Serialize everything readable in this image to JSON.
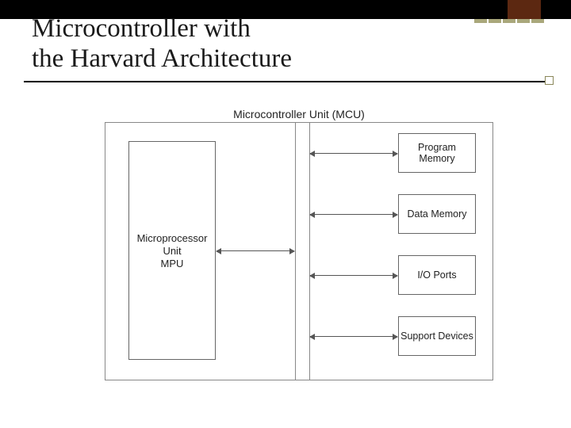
{
  "slide": {
    "title_line1": "Microcontroller with",
    "title_line2": "the Harvard Architecture"
  },
  "diagram": {
    "outer_label": "Microcontroller Unit (MCU)",
    "mpu": {
      "line1": "Microprocessor",
      "line2": "Unit",
      "line3": "MPU"
    },
    "boxes": [
      "Program Memory",
      "Data Memory",
      "I/O Ports",
      "Support Devices"
    ]
  },
  "chart_data": {
    "type": "diagram",
    "title": "Microcontroller with the Harvard Architecture",
    "container": "Microcontroller Unit (MCU)",
    "nodes": [
      {
        "id": "mpu",
        "label": "Microprocessor Unit MPU"
      },
      {
        "id": "bus",
        "label": "Internal bus"
      },
      {
        "id": "prog_mem",
        "label": "Program Memory"
      },
      {
        "id": "data_mem",
        "label": "Data Memory"
      },
      {
        "id": "io_ports",
        "label": "I/O Ports"
      },
      {
        "id": "support",
        "label": "Support Devices"
      }
    ],
    "edges": [
      {
        "from": "mpu",
        "to": "bus",
        "bidirectional": true
      },
      {
        "from": "bus",
        "to": "prog_mem",
        "bidirectional": true
      },
      {
        "from": "bus",
        "to": "data_mem",
        "bidirectional": true
      },
      {
        "from": "bus",
        "to": "io_ports",
        "bidirectional": true
      },
      {
        "from": "bus",
        "to": "support",
        "bidirectional": true
      }
    ]
  }
}
